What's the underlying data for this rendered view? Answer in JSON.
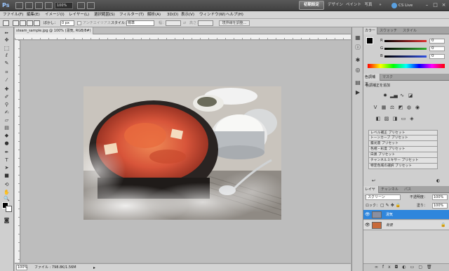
{
  "app": {
    "logo": "Ps",
    "zoom_select": "100%",
    "workspaces": {
      "active": "初期設定",
      "items": [
        "デザイン",
        "ペイント",
        "写真"
      ],
      "more": "»"
    },
    "cs_live": "CS Live",
    "window_controls": [
      "–",
      "□",
      "×"
    ]
  },
  "menu": {
    "items": [
      "ファイル(F)",
      "編集(E)",
      "イメージ(I)",
      "レイヤー(L)",
      "選択範囲(S)",
      "フィルター(T)",
      "解析(A)",
      "3D(D)",
      "表示(V)",
      "ウィンドウ(W)",
      "ヘルプ(H)"
    ]
  },
  "options": {
    "feather_label": "ぼかし：",
    "feather_value": "0 px",
    "antialias_label": "アンチエイリアス",
    "style_label": "スタイル：",
    "style_value": "標準",
    "width_label": "幅：",
    "height_label": "高さ：",
    "refine_edge": "境界線を調整..."
  },
  "document": {
    "tab_title": "steam_sample.jpg @ 100% (湯気, RGB/8#) *",
    "tab_close": "×",
    "status_zoom": "100%",
    "status_file": "ファイル : 798.8K/1.56M"
  },
  "color_panel": {
    "tabs": [
      "カラー",
      "スウォッチ",
      "スタイル"
    ],
    "channels": [
      {
        "label": "R",
        "value": "0",
        "color": "#e03030"
      },
      {
        "label": "G",
        "value": "0",
        "color": "#30b030"
      },
      {
        "label": "B",
        "value": "0",
        "color": "#3050e0"
      }
    ]
  },
  "adjust_panel": {
    "tabs": [
      "色調補正",
      "マスク"
    ],
    "title": "色調補正を追加",
    "presets": [
      "レベル補正 プリセット",
      "トーンカーブ プリセット",
      "露光量 プリセット",
      "色相・彩度 プリセット",
      "白黒 プリセット",
      "チャンネルミキサー プリセット",
      "特定色域の選択 プリセット"
    ]
  },
  "layers_panel": {
    "tabs": [
      "レイヤー",
      "チャンネル",
      "パス"
    ],
    "blend_mode": "スクリーン",
    "opacity_label": "不透明度：",
    "opacity_value": "100%",
    "lock_label": "ロック：",
    "fill_label": "塗り：",
    "fill_value": "100%",
    "layers": [
      {
        "name": "湯気",
        "selected": true
      },
      {
        "name": "背景",
        "selected": false
      }
    ]
  }
}
